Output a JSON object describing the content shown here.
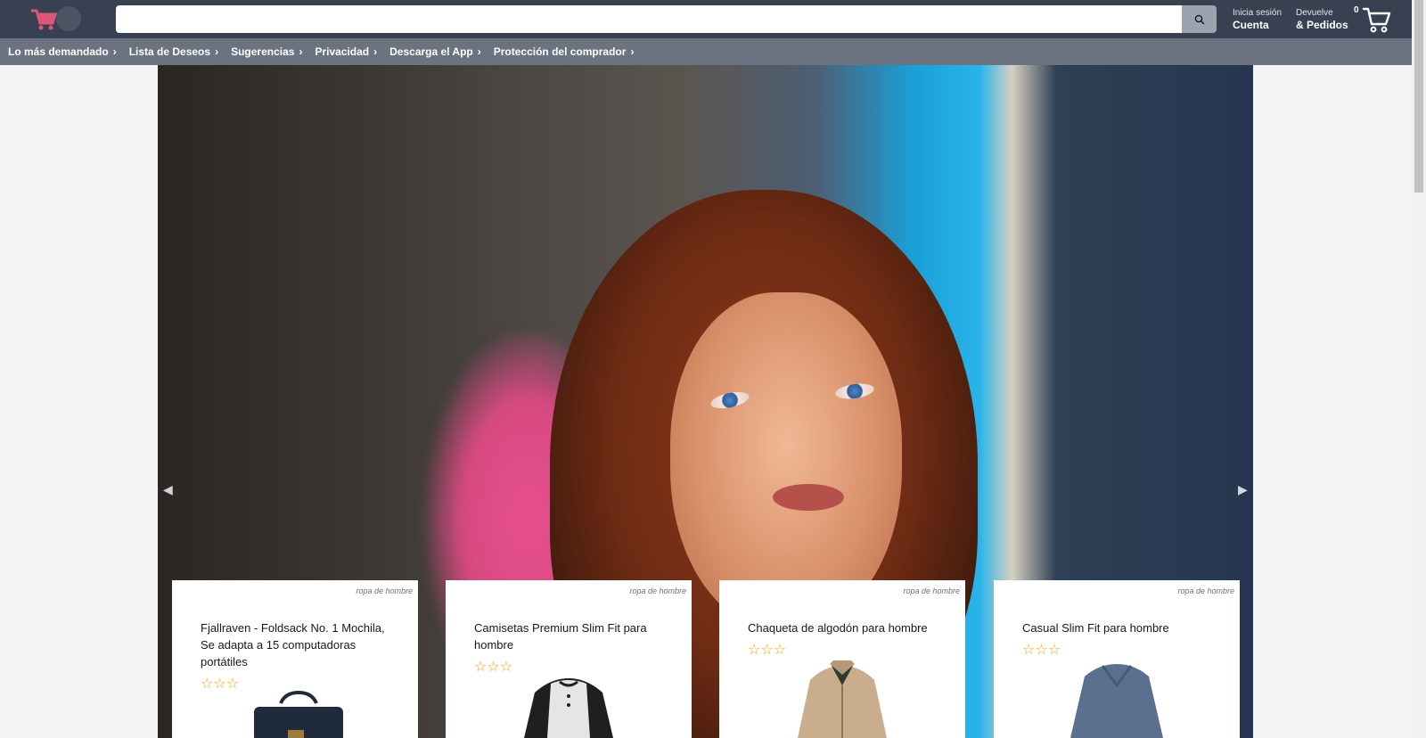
{
  "header": {
    "logo_icon": "cart-logo-icon",
    "search_placeholder": "",
    "search_icon": "search-icon",
    "account": {
      "small": "Inicia sesión",
      "big": "Cuenta"
    },
    "orders": {
      "small": "Devuelve",
      "big": "& Pedidos"
    },
    "cart_count": "0",
    "cart_icon": "shopping-cart-icon"
  },
  "nav": {
    "items": [
      {
        "label": "Lo más demandado"
      },
      {
        "label": "Lista de Deseos"
      },
      {
        "label": "Sugerencias"
      },
      {
        "label": "Privacidad"
      },
      {
        "label": "Descarga el App"
      },
      {
        "label": "Protección del comprador"
      }
    ],
    "chevron_icon": "chevron-right-icon"
  },
  "hero": {
    "prev_icon": "carousel-prev-icon",
    "next_icon": "carousel-next-icon"
  },
  "products": [
    {
      "category": "ropa de hombre",
      "title": "Fjallraven - Foldsack No. 1 Mochila, Se adapta a 15 computadoras portátiles",
      "rating_stars": 3,
      "image_icon": "backpack-image"
    },
    {
      "category": "ropa de hombre",
      "title": "Camisetas Premium Slim Fit para hombre",
      "rating_stars": 3,
      "image_icon": "tshirt-image"
    },
    {
      "category": "ropa de hombre",
      "title": "Chaqueta de algodón para hombre",
      "rating_stars": 3,
      "image_icon": "jacket-image"
    },
    {
      "category": "ropa de hombre",
      "title": "Casual Slim Fit para hombre",
      "rating_stars": 3,
      "image_icon": "sweater-image"
    }
  ],
  "colors": {
    "header_bg": "#374151",
    "nav_bg": "#6b7280",
    "star": "#f59e0b"
  }
}
